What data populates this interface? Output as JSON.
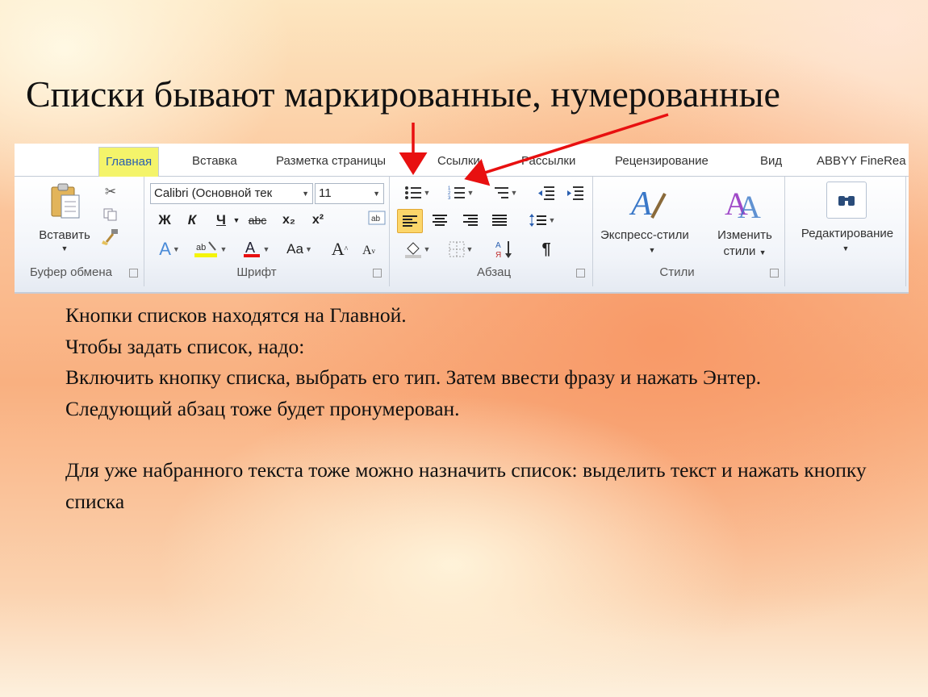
{
  "slide": {
    "title": "Списки бывают маркированные, нумерованные",
    "lines": [
      "Кнопки списков находятся на Главной.",
      "Чтобы задать список, надо:",
      "Включить кнопку списка, выбрать его тип. Затем ввести фразу и нажать Энтер.",
      "Следующий абзац тоже будет пронумерован.",
      "",
      "Для уже набранного текста тоже можно назначить список: выделить текст и нажать кнопку списка"
    ]
  },
  "ribbon": {
    "tabs": [
      "Главная",
      "Вставка",
      "Разметка страницы",
      "Ссылки",
      "Рассылки",
      "Рецензирование",
      "Вид",
      "ABBYY FineRea"
    ],
    "active_tab": "Главная",
    "clipboard": {
      "paste_label": "Вставить",
      "group_label": "Буфер обмена"
    },
    "font": {
      "font_name": "Calibri (Основной тек",
      "font_size": "11",
      "bold": "Ж",
      "italic": "К",
      "underline": "Ч",
      "strike": "abc",
      "subscript": "x₂",
      "superscript": "x²",
      "change_case": "Aa",
      "grow": "A",
      "shrink": "A",
      "group_label": "Шрифт"
    },
    "paragraph": {
      "pilcrow": "¶",
      "group_label": "Абзац"
    },
    "styles": {
      "express_label": "Экспресс-стили",
      "change_label_1": "Изменить",
      "change_label_2": "стили",
      "group_label": "Стили"
    },
    "editing": {
      "label": "Редактирование"
    }
  },
  "colors": {
    "arrow": "#e81010",
    "active_tab_bg": "#f4f46a",
    "active_tab_text": "#2a5fb0"
  }
}
